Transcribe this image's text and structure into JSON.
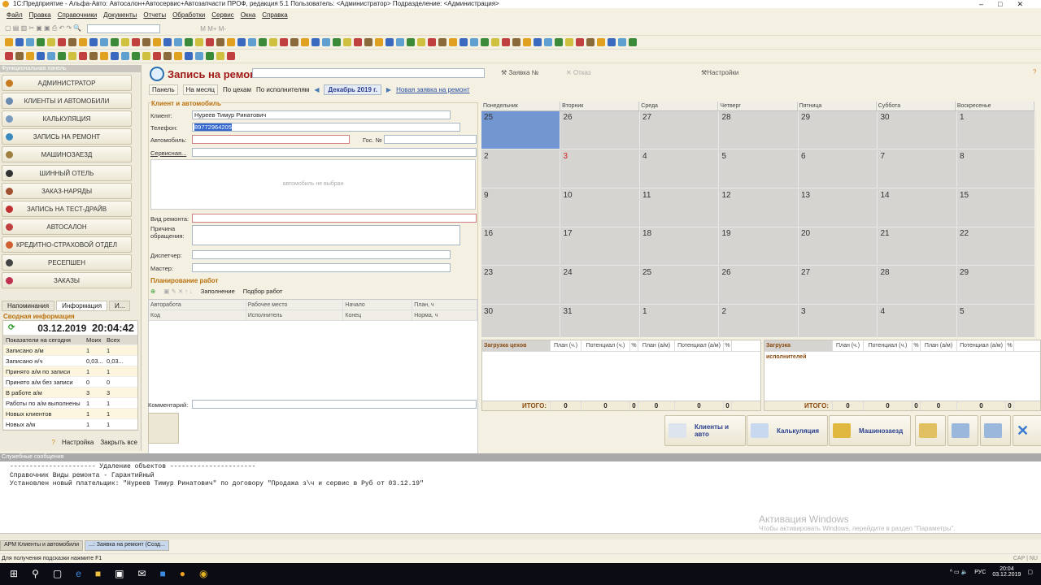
{
  "window": {
    "title": "1С:Предприятие - Альфа-Авто: Автосалон+Автосервис+Автозапчасти ПРОФ, редакция 5.1    Пользователь: <Администратор>    Подразделение: <Администрация>"
  },
  "menu": [
    "Файл",
    "Правка",
    "Справочники",
    "Документы",
    "Отчеты",
    "Обработки",
    "Сервис",
    "Окна",
    "Справка"
  ],
  "toolbar": {
    "mark_labels": [
      "M",
      "M+",
      "M-"
    ]
  },
  "left_panel": {
    "title": "Функциональная панель",
    "items": [
      {
        "label": "АДМИНИСТРАТОР",
        "icon": "shield-icon",
        "color": "#c87a20"
      },
      {
        "label": "КЛИЕНТЫ И АВТОМОБИЛИ",
        "icon": "client-card-icon",
        "color": "#6a8ab0"
      },
      {
        "label": "КАЛЬКУЛЯЦИЯ",
        "icon": "calculator-icon",
        "color": "#7a9ac0"
      },
      {
        "label": "ЗАПИСЬ НА РЕМОНТ",
        "icon": "repair-clock-icon",
        "color": "#3a8ac0"
      },
      {
        "label": "МАШИНОЗАЕЗД",
        "icon": "car-icon",
        "color": "#a08040"
      },
      {
        "label": "ШИННЫЙ ОТЕЛЬ",
        "icon": "tire-icon",
        "color": "#333333"
      },
      {
        "label": "ЗАКАЗ-НАРЯДЫ",
        "icon": "tools-icon",
        "color": "#a05030"
      },
      {
        "label": "ЗАПИСЬ НА ТЕСТ-ДРАЙВ",
        "icon": "test-drive-icon",
        "color": "#c03030"
      },
      {
        "label": "АВТОСАЛОН",
        "icon": "car-red-icon",
        "color": "#c04040"
      },
      {
        "label": "КРЕДИТНО-СТРАХОВОЙ ОТДЕЛ",
        "icon": "lifebuoy-icon",
        "color": "#d06030"
      },
      {
        "label": "РЕСЕПШЕН",
        "icon": "headset-icon",
        "color": "#444444"
      },
      {
        "label": "ЗАКАЗЫ",
        "icon": "order-car-icon",
        "color": "#c03050"
      }
    ],
    "tabs": [
      "Напоминания",
      "Информация",
      "И..."
    ],
    "summary_title": "Сводная информация",
    "date": "03.12.2019",
    "time": "20:04:42",
    "table_head": [
      "Показатели на сегодня",
      "Моих",
      "Всех"
    ],
    "rows": [
      [
        "Записано а/м",
        "1",
        "1"
      ],
      [
        "Записано н/ч",
        "0,03...",
        "0,03..."
      ],
      [
        "Принято а/м по записи",
        "1",
        "1"
      ],
      [
        "Принято а/м без записи",
        "0",
        "0"
      ],
      [
        "В работе а/м",
        "3",
        "3"
      ],
      [
        "Работы по а/м выполнены",
        "1",
        "1"
      ],
      [
        "Новых клиентов",
        "1",
        "1"
      ],
      [
        "Новых а/м",
        "1",
        "1"
      ]
    ],
    "settings": "Настройка",
    "close_all": "Закрыть все"
  },
  "form": {
    "title": "Запись на ремонт",
    "order_no": "Заявка №",
    "cancel": "Отказ",
    "settings": "Настройки",
    "tb": {
      "panel": "Панель",
      "month": "На месяц",
      "shops": "По цехам",
      "performers": "По исполнителям",
      "period": "Декабрь 2019 г.",
      "new_order": "Новая заявка на ремонт"
    },
    "group": "Клиент и автомобиль",
    "client_label": "Клиент:",
    "client": "Нуреев Тимур Ринатович",
    "phone_label": "Телефон:",
    "phone": "89772964205",
    "car_label": "Автомобиль:",
    "plate_label": "Гос. №",
    "service_label": "Сервисная...",
    "no_car": "автомобиль не выбран",
    "repair_type_label": "Вид ремонта:",
    "reason_label": "Причина обращения:",
    "dispatcher_label": "Диспетчер:",
    "master_label": "Мастер:",
    "planning": "Планирование работ",
    "fill": "Заполнение",
    "pick": "Подбор работ",
    "cols1": [
      "Авторабота",
      "Рабочее место",
      "Начало",
      "План, ч"
    ],
    "cols2": [
      "Код",
      "Исполнитель",
      "Конец",
      "Норма, ч"
    ],
    "comment_label": "Комментарий:"
  },
  "calendar": {
    "days": [
      "Понедельник",
      "Вторник",
      "Среда",
      "Четверг",
      "Пятница",
      "Суббота",
      "Воскресенье"
    ],
    "weeks": [
      [
        "25",
        "26",
        "27",
        "28",
        "29",
        "30",
        "1"
      ],
      [
        "2",
        "3",
        "4",
        "5",
        "6",
        "7",
        "8"
      ],
      [
        "9",
        "10",
        "11",
        "12",
        "13",
        "14",
        "15"
      ],
      [
        "16",
        "17",
        "18",
        "19",
        "20",
        "21",
        "22"
      ],
      [
        "23",
        "24",
        "25",
        "26",
        "27",
        "28",
        "29"
      ],
      [
        "30",
        "31",
        "1",
        "2",
        "3",
        "4",
        "5"
      ]
    ],
    "selected": "25",
    "highlight_red": "3",
    "selected_color": "#7196d0"
  },
  "load_shops": {
    "title": "Загрузка цехов",
    "cols": [
      "План (ч.)",
      "Потенциал (ч.)",
      "%",
      "План (а/м)",
      "Потенциал (а/м)",
      "%"
    ],
    "total_label": "ИТОГО:",
    "totals": [
      "0",
      "0",
      "0",
      "0",
      "0",
      "0"
    ]
  },
  "load_perf": {
    "title": "Загрузка исполнителей",
    "cols": [
      "План (ч.)",
      "Потенциал (ч.)",
      "%",
      "План (а/м)",
      "Потенциал (а/м)",
      "%"
    ],
    "total_label": "ИТОГО:",
    "totals": [
      "0",
      "0",
      "0",
      "0",
      "0",
      "0"
    ]
  },
  "actions": [
    "Клиенты и авто",
    "Калькуляция",
    "Машинозаезд"
  ],
  "messages": {
    "title": "Служебные сообщения",
    "lines": [
      "---------------------- Удаление объектов ----------------------",
      "Справочник Виды ремонта - Гарантийный",
      "Установлен новый плательщик: \"Нуреев Тимур Ринатович\" по договору \"Продажа з\\ч и сервис в Руб от 03.12.19\""
    ]
  },
  "activation": {
    "title": "Активация Windows",
    "text": "Чтобы активировать Windows, перейдите в раздел \"Параметры\"."
  },
  "window_tabs": [
    "АРМ Клиенты и автомобили",
    "...: Заявка на ремонт (Созд..."
  ],
  "status": {
    "hint": "Для получения подсказки нажмите F1",
    "caps": "CAP",
    "num": "NU"
  },
  "taskbar": {
    "lang": "РУС",
    "time": "20:04",
    "date": "03.12.2019"
  }
}
